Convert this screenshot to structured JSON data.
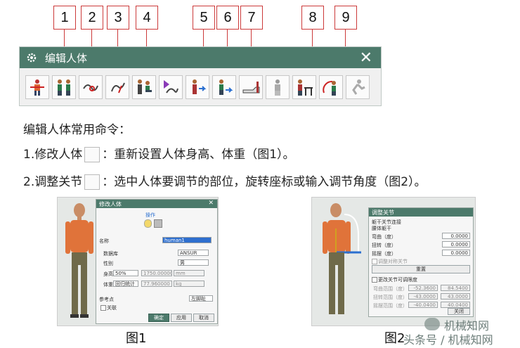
{
  "callouts": [
    "1",
    "2",
    "3",
    "4",
    "5",
    "6",
    "7",
    "8",
    "9"
  ],
  "toolbar_window": {
    "title": "编辑人体",
    "close_symbol": "✕",
    "tool_icons": [
      "positioning-icon",
      "modify-human-icon",
      "adjust-joint-icon",
      "posture-icon",
      "seated-human-icon",
      "reach-icon",
      "attach-icon",
      "hand-attach-icon",
      "pointing-hand-icon",
      "gray-human-icon",
      "desk-human-icon",
      "reach-zone-icon",
      "disabled-human-icon"
    ]
  },
  "text": {
    "heading": "编辑人体常用命令：",
    "line1_prefix": "1.修改人体",
    "line1_suffix": "：重新设置人体身高、体重（图1）。",
    "line2_prefix": "2.调整关节",
    "line2_suffix": "：选中人体要调节的部位，旋转座标或输入调节角度（图2）。"
  },
  "fig1": {
    "dialog_title": "修改人体",
    "close_symbol": "✕",
    "section_label": "操作",
    "name_label": "名称",
    "name_value": "human1",
    "database_label": "数据库",
    "database_value": "ANSUR",
    "gender_label": "性别",
    "gender_value": "男",
    "height_label": "身高",
    "height_percent": "50%",
    "height_value": "1750.000000",
    "height_unit": "mm",
    "weight_label": "体重",
    "weight_method": "回归统计",
    "weight_value": "77.960000",
    "weight_unit": "kg",
    "ref_label": "参考点",
    "ref_value": "左脚趾",
    "link_label": "关联",
    "ok": "确定",
    "apply": "应用",
    "cancel": "取消",
    "caption": "图1"
  },
  "fig2": {
    "dialog_title": "调整关节",
    "group_label": "躯干关节连接",
    "sub_label": "腰体躯干",
    "bend_label": "弯曲（度）",
    "bend_value": "0.0000",
    "twist_label": "扭转（度）",
    "twist_value": "0.0000",
    "side_label": "摇摆（度）",
    "side_value": "0.0000",
    "sym_label": "调整对称关节",
    "reset": "重置",
    "limits_label": "更改关节可调限度",
    "bend_range_label": "弯曲范围（度）",
    "bend_min": "-52.3600",
    "bend_max": "84.5400",
    "twist_range_label": "扭转范围（度）",
    "twist_min": "-43.0000",
    "twist_max": "43.0000",
    "side_range_label": "摇摆范围（度）",
    "side_min": "-40.0400",
    "side_max": "40.0400",
    "close": "关闭",
    "caption": "图2"
  },
  "watermark": {
    "top": "机械知网",
    "bottom": "头条号 / 机械知网"
  },
  "colors": {
    "title_bar": "#4c7a6b",
    "callout_border": "#cc3a3a",
    "selection": "#2f6fce"
  }
}
